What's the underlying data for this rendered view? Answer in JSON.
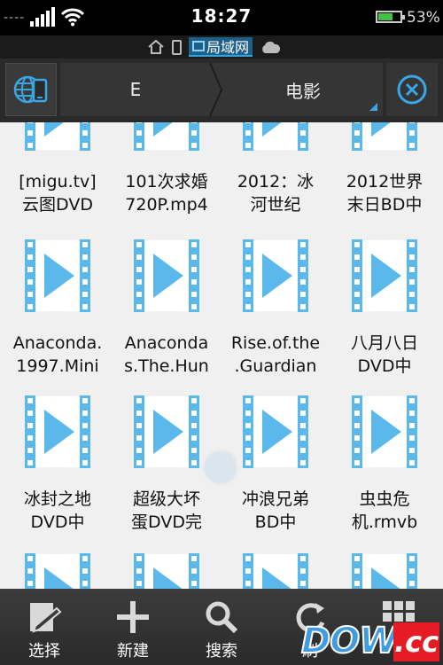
{
  "status_bar": {
    "signal_dashes": "----",
    "time": "18:27",
    "battery_percent": "53%",
    "battery_level": 0.6
  },
  "location": {
    "active_label": "局域网",
    "icons": [
      "home-icon",
      "phone-icon",
      "lan-icon",
      "cloud-icon"
    ]
  },
  "path_bar": {
    "network_icon": "globe-device-icon",
    "crumbs": [
      "E",
      "电影"
    ],
    "close_icon": "close-circle-icon"
  },
  "files": [
    {
      "line1": "[migu.tv]",
      "line2": "云图DVD"
    },
    {
      "line1": "101次求婚",
      "line2": "720P.mp4"
    },
    {
      "line1": "2012：冰",
      "line2": "河世纪"
    },
    {
      "line1": "2012世界",
      "line2": "末日BD中"
    },
    {
      "line1": "Anaconda.",
      "line2": "1997.Mini"
    },
    {
      "line1": "Anaconda",
      "line2": "s.The.Hun"
    },
    {
      "line1": "Rise.of.the",
      "line2": ".Guardian"
    },
    {
      "line1": "八月八日",
      "line2": "DVD中"
    },
    {
      "line1": "冰封之地",
      "line2": "DVD中"
    },
    {
      "line1": "超级大坏",
      "line2": "蛋DVD完"
    },
    {
      "line1": "冲浪兄弟",
      "line2": "BD中"
    },
    {
      "line1": "虫虫危",
      "line2": "机.rmvb"
    }
  ],
  "toolbar": {
    "buttons": [
      {
        "label": "选择",
        "icon": "select-edit-icon"
      },
      {
        "label": "新建",
        "icon": "plus-icon"
      },
      {
        "label": "搜索",
        "icon": "search-icon"
      },
      {
        "label": "刷",
        "icon": "refresh-icon"
      },
      {
        "label": "",
        "icon": "grid-view-icon"
      }
    ]
  },
  "watermark": {
    "text1": "DOWN",
    "text2": ".cc"
  },
  "colors": {
    "accent": "#3aa6e6",
    "video_blue": "#5bb8ea"
  }
}
